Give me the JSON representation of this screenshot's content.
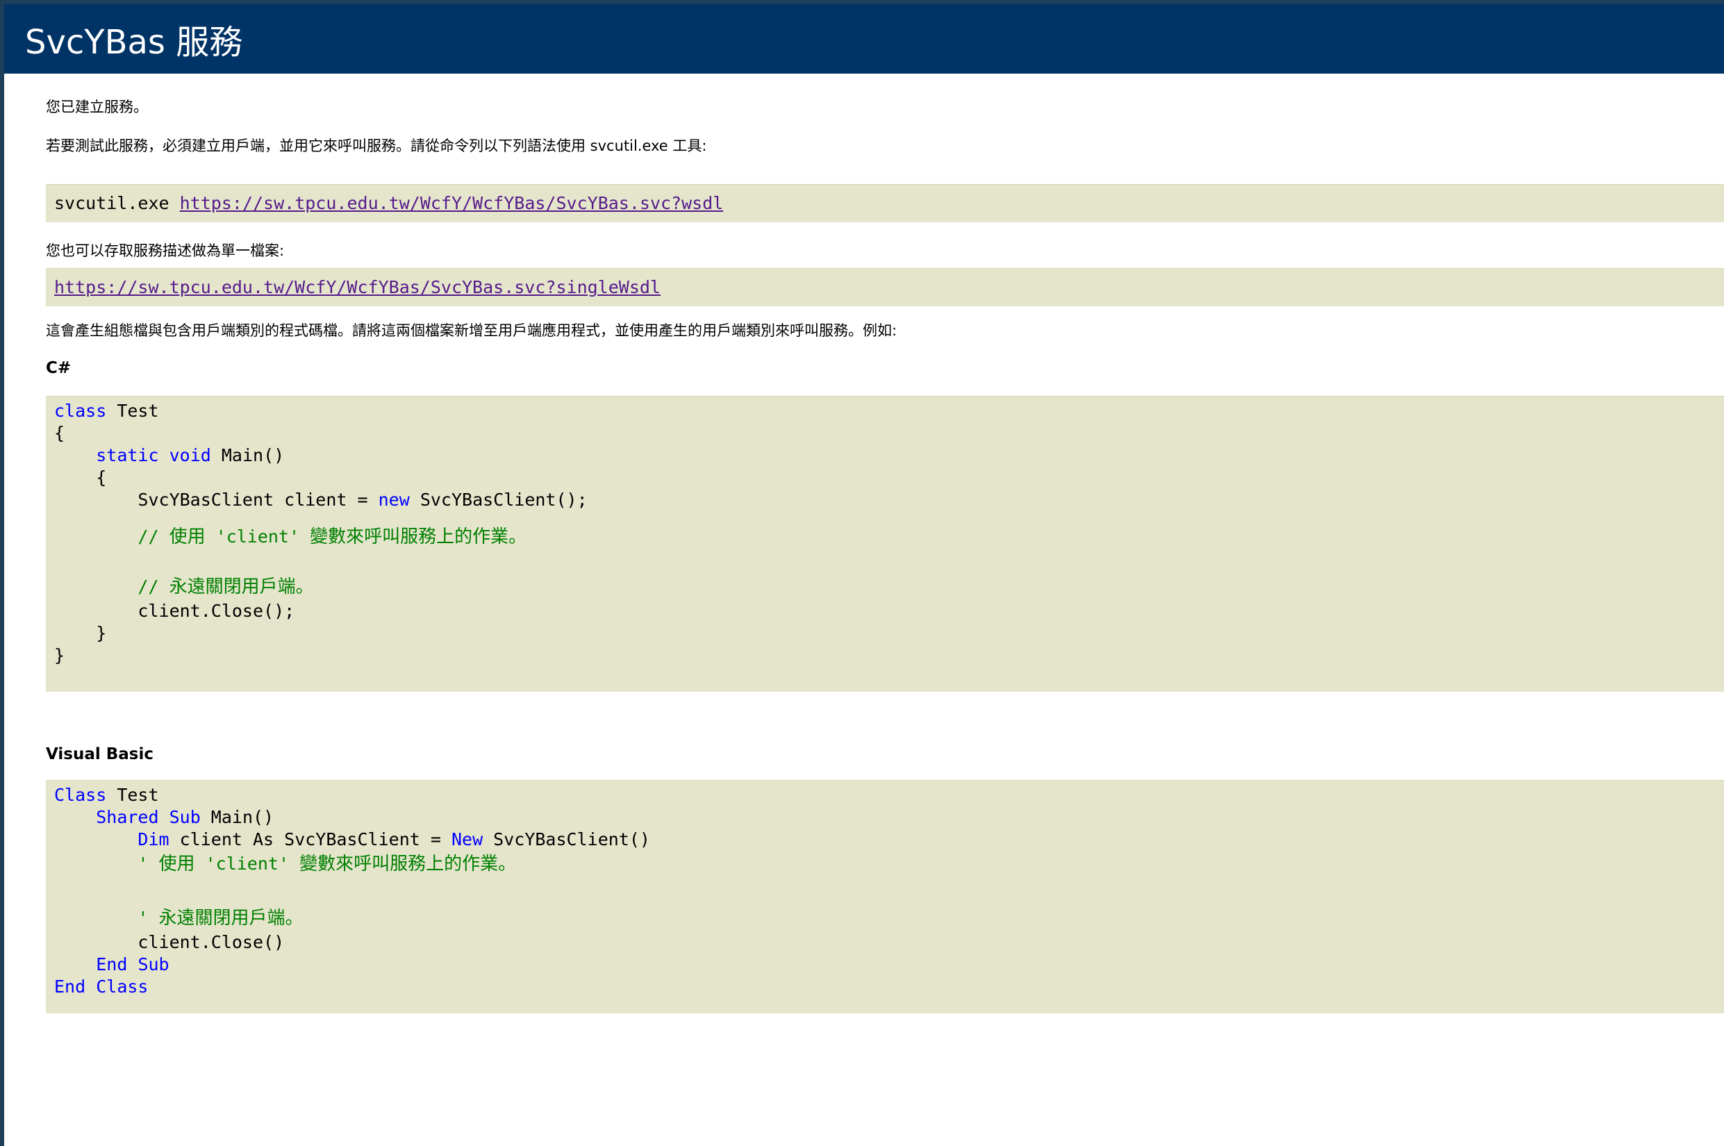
{
  "header": {
    "title": "SvcYBas 服務"
  },
  "intro": {
    "created": "您已建立服務。",
    "test_instructions": "若要測試此服務，必須建立用戶端，並用它來呼叫服務。請從命令列以下列語法使用 svcutil.exe 工具:"
  },
  "svcutil": {
    "command": "svcutil.exe",
    "wsdl_url": "https://sw.tpcu.edu.tw/WcfY/WcfYBas/SvcYBas.svc?wsdl"
  },
  "single_file": {
    "text": "您也可以存取服務描述做為單一檔案:",
    "url": "https://sw.tpcu.edu.tw/WcfY/WcfYBas/SvcYBas.svc?singleWsdl"
  },
  "generate_text": "這會產生組態檔與包含用戶端類別的程式碼檔。請將這兩個檔案新增至用戶端應用程式，並使用產生的用戶端類別來呼叫服務。例如:",
  "csharp": {
    "heading": "C#",
    "kw_class": "class",
    "class_name": " Test",
    "open_brace": "{",
    "kw_static": "static",
    "kw_void": "void",
    "main_sig": " Main()",
    "inner_open": "{",
    "client_decl_start": "SvcYBasClient client = ",
    "kw_new": "new",
    "client_decl_end": " SvcYBasClient();",
    "comment1_prefix": "// ",
    "comment1_a": "使用",
    "comment1_b": " 'client' ",
    "comment1_c": "變數來呼叫服務上的作業。",
    "comment2_prefix": "// ",
    "comment2_text": "永遠關閉用戶端。",
    "close_call": "client.Close();",
    "inner_close": "}",
    "close_brace": "}"
  },
  "vb": {
    "heading": "Visual Basic",
    "kw_class": "Class",
    "class_name": " Test",
    "kw_shared": "Shared",
    "kw_sub": "Sub",
    "main_sig": " Main()",
    "kw_dim": "Dim",
    "dim_mid": " client As SvcYBasClient = ",
    "kw_new": "New",
    "dim_end": " SvcYBasClient()",
    "comment1_prefix": "' ",
    "comment1_a": "使用",
    "comment1_b": " 'client' ",
    "comment1_c": "變數來呼叫服務上的作業。",
    "comment2_prefix": "' ",
    "comment2_text": "永遠關閉用戶端。",
    "close_call": "client.Close()",
    "kw_end": "End",
    "kw_end_sub": "Sub",
    "kw_end2": "End",
    "kw_end_class": "Class"
  },
  "colors": {
    "header_bg": "#003366",
    "code_bg": "#e5e5cc",
    "keyword": "#0000ff",
    "comment": "#008000",
    "link": "#551a8b"
  }
}
